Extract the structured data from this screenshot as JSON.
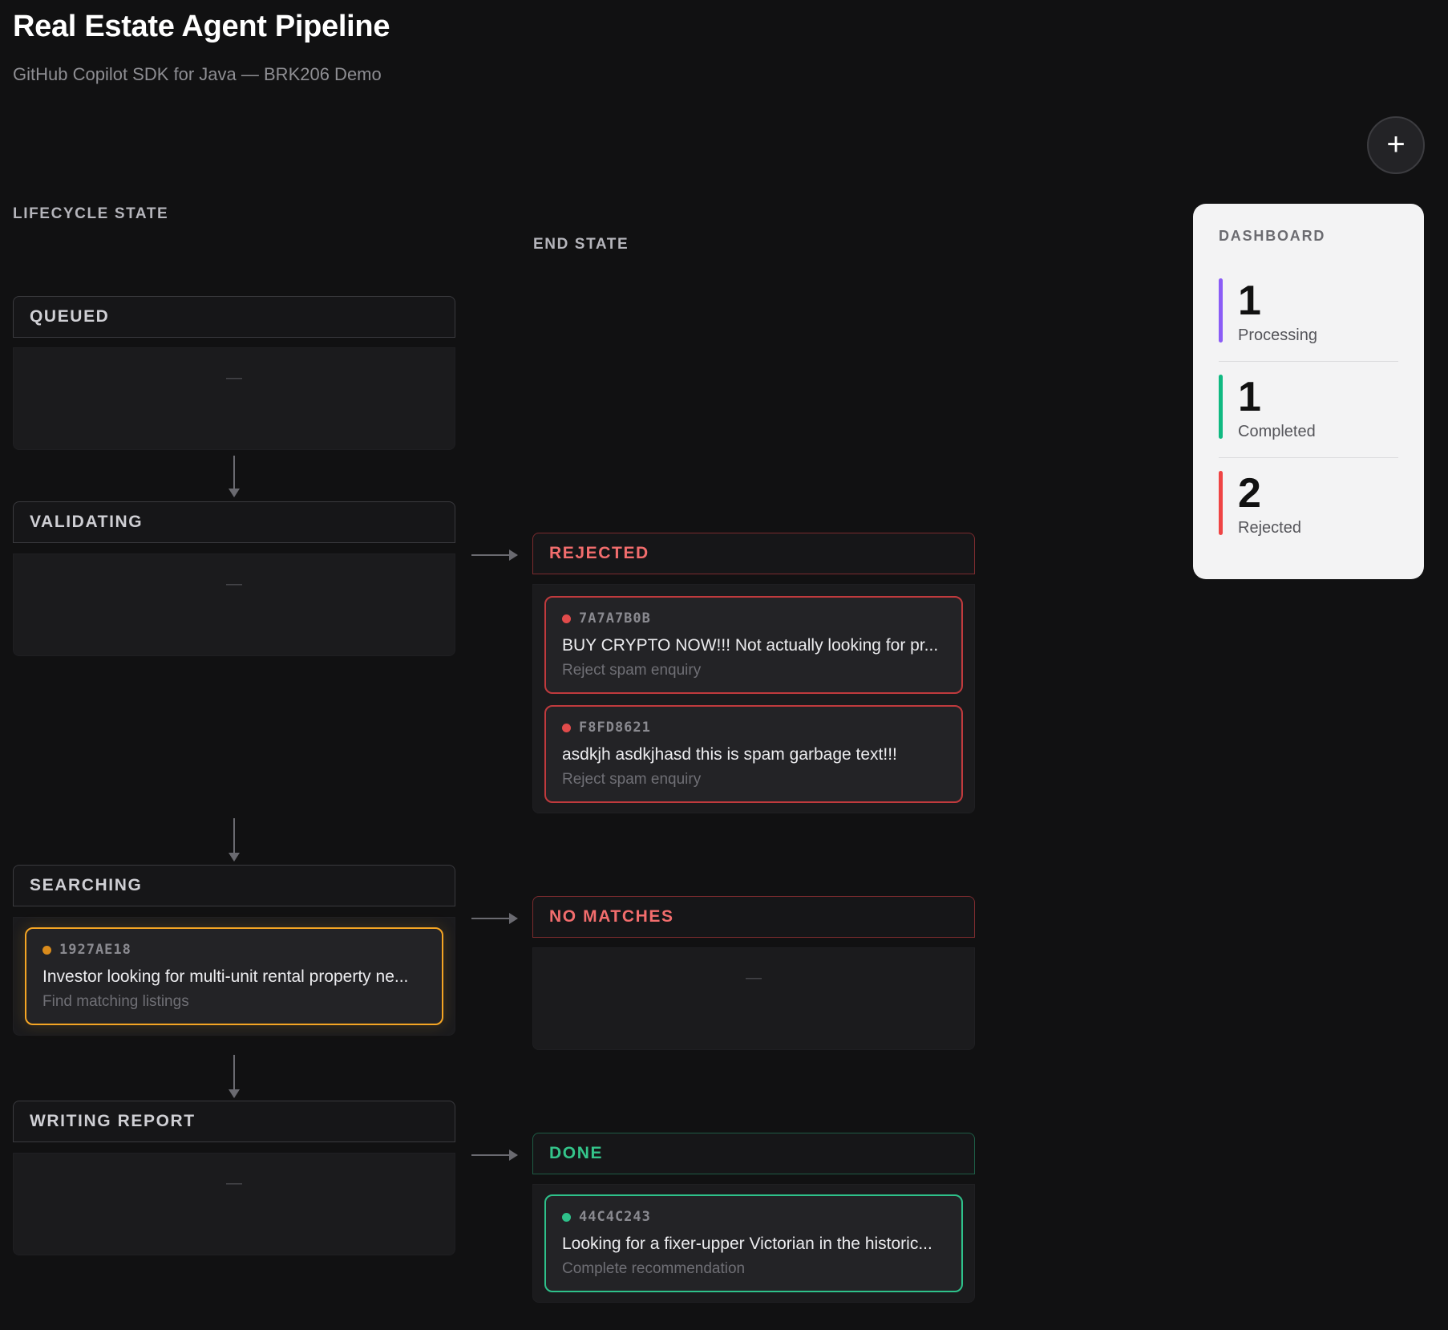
{
  "header": {
    "title": "Real Estate Agent Pipeline",
    "subtitle": "GitHub Copilot SDK for Java — BRK206 Demo",
    "add_symbol": "+"
  },
  "labels": {
    "lifecycle": "LIFECYCLE STATE",
    "end_state": "END STATE"
  },
  "lifecycle": {
    "queued": {
      "label": "QUEUED",
      "empty": "—"
    },
    "validating": {
      "label": "VALIDATING",
      "empty": "—"
    },
    "searching": {
      "label": "SEARCHING",
      "cards": [
        {
          "id": "1927AE18",
          "text": "Investor looking for multi-unit rental property ne...",
          "sub": "Find matching listings"
        }
      ]
    },
    "writing_report": {
      "label": "WRITING REPORT",
      "empty": "—"
    }
  },
  "end_states": {
    "rejected": {
      "label": "REJECTED",
      "cards": [
        {
          "id": "7A7A7B0B",
          "text": "BUY CRYPTO NOW!!! Not actually looking for pr...",
          "sub": "Reject spam enquiry"
        },
        {
          "id": "F8FD8621",
          "text": "asdkjh asdkjhasd this is spam garbage text!!!",
          "sub": "Reject spam enquiry"
        }
      ]
    },
    "no_matches": {
      "label": "NO MATCHES",
      "empty": "—"
    },
    "done": {
      "label": "DONE",
      "cards": [
        {
          "id": "44C4C243",
          "text": "Looking for a fixer-upper Victorian in the historic...",
          "sub": "Complete recommendation"
        }
      ]
    }
  },
  "dashboard": {
    "label": "DASHBOARD",
    "stats": [
      {
        "value": "1",
        "label": "Processing",
        "color": "#8b5cf6"
      },
      {
        "value": "1",
        "label": "Completed",
        "color": "#10b981"
      },
      {
        "value": "2",
        "label": "Rejected",
        "color": "#ef4444"
      }
    ]
  },
  "colors": {
    "background": "#111112",
    "reject": "#f26d6d",
    "processing": "#f5a524",
    "done": "#2ec18a"
  }
}
